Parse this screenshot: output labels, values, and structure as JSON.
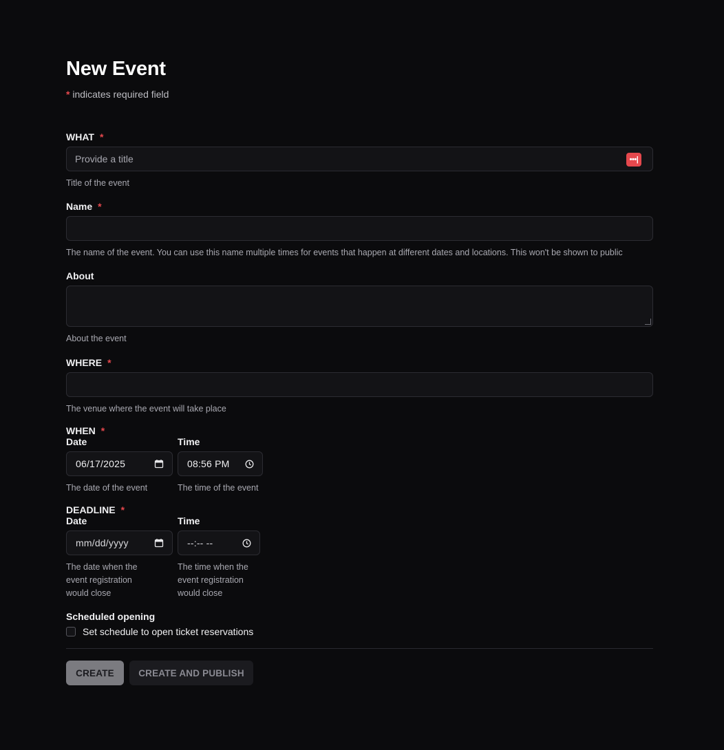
{
  "title": "New Event",
  "required_note": {
    "star": "*",
    "text": "indicates required field"
  },
  "what": {
    "label": "WHAT",
    "star": "*",
    "placeholder": "Provide a title",
    "help": "Title of the event",
    "password_icon_glyph": "•••|"
  },
  "name": {
    "label": "Name",
    "star": "*",
    "value": "",
    "help": "The name of the event. You can use this name multiple times for events that happen at different dates and locations. This won't be shown to public"
  },
  "about": {
    "label": "About",
    "value": "",
    "help": "About the event"
  },
  "where": {
    "label": "WHERE",
    "star": "*",
    "value": "",
    "help": "The venue where the event will take place"
  },
  "when": {
    "label": "WHEN",
    "star": "*",
    "date_label": "Date",
    "date_value": "06/17/2025",
    "date_help": "The date of the event",
    "time_label": "Time",
    "time_value": "08:56 PM",
    "time_help": "The time of the event"
  },
  "deadline": {
    "label": "DEADLINE",
    "star": "*",
    "date_label": "Date",
    "date_value": "mm/dd/yyyy",
    "date_help": "The date when the event registration would close",
    "time_label": "Time",
    "time_value": "--:-- --",
    "time_help": "The time when the event registration would close"
  },
  "scheduled_opening": {
    "label": "Scheduled opening",
    "checkbox_label": "Set schedule to open ticket reservations",
    "checked": false
  },
  "buttons": {
    "create": "CREATE",
    "create_publish": "CREATE AND PUBLISH"
  },
  "colors": {
    "background": "#0b0b0d",
    "required": "#e5484d",
    "input_bg": "#131316",
    "primary_button": "#7b7b80"
  }
}
